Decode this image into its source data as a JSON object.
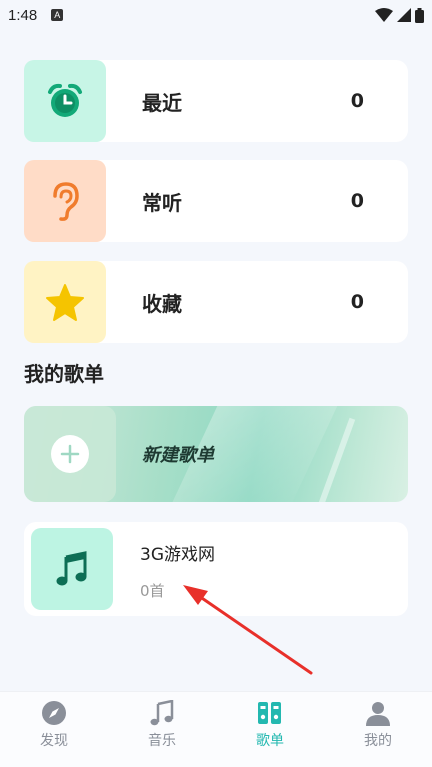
{
  "status_bar": {
    "time": "1:48",
    "a_icon": "A"
  },
  "cards": [
    {
      "label": "最近",
      "count": "0",
      "icon": "alarm-clock-icon",
      "tile_color": "#c7f5e6"
    },
    {
      "label": "常听",
      "count": "0",
      "icon": "ear-icon",
      "tile_color": "#ffdcc7"
    },
    {
      "label": "收藏",
      "count": "0",
      "icon": "star-icon",
      "tile_color": "#fff3c4"
    }
  ],
  "section_title": "我的歌单",
  "new_playlist": {
    "label": "新建歌单",
    "icon": "plus-icon"
  },
  "playlist": {
    "name": "3G游戏网",
    "count": "0首",
    "icon": "music-note-icon"
  },
  "tabs": [
    {
      "label": "发现",
      "icon": "compass-icon",
      "active": false
    },
    {
      "label": "音乐",
      "icon": "music-note-icon",
      "active": false
    },
    {
      "label": "歌单",
      "icon": "playlist-icon",
      "active": true
    },
    {
      "label": "我的",
      "icon": "user-icon",
      "active": false
    }
  ],
  "colors": {
    "accent": "#23b8b0",
    "annotation_arrow": "#e8302a"
  }
}
